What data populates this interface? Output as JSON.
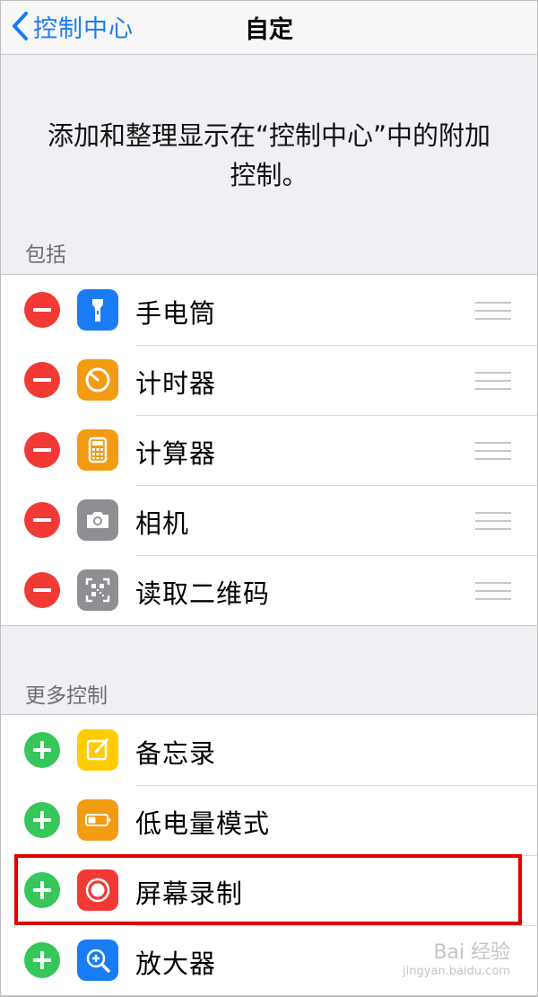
{
  "nav": {
    "back_label": "控制中心",
    "title": "自定"
  },
  "description": "添加和整理显示在“控制中心”中的附加控制。",
  "included": {
    "header": "包括",
    "items": [
      {
        "label": "手电筒",
        "icon": "flashlight-icon",
        "color": "#1a7cf5"
      },
      {
        "label": "计时器",
        "icon": "timer-icon",
        "color": "#f39b12"
      },
      {
        "label": "计算器",
        "icon": "calculator-icon",
        "color": "#f39b12"
      },
      {
        "label": "相机",
        "icon": "camera-icon",
        "color": "#8e8e93"
      },
      {
        "label": "读取二维码",
        "icon": "qr-code-icon",
        "color": "#8e8e93"
      }
    ]
  },
  "more": {
    "header": "更多控制",
    "items": [
      {
        "label": "备忘录",
        "icon": "notes-icon",
        "color": "#ffcc00"
      },
      {
        "label": "低电量模式",
        "icon": "battery-icon",
        "color": "#f39b12"
      },
      {
        "label": "屏幕录制",
        "icon": "screen-record-icon",
        "color": "#f23a35"
      },
      {
        "label": "放大器",
        "icon": "magnifier-icon",
        "color": "#1a7cf5"
      }
    ]
  },
  "colors": {
    "accent": "#1a7cf5",
    "remove": "#f23a35",
    "add": "#35c759",
    "highlight": "#e10000"
  },
  "watermark": {
    "text": "Bai 经验",
    "sub": "jingyan.baidu.com"
  }
}
